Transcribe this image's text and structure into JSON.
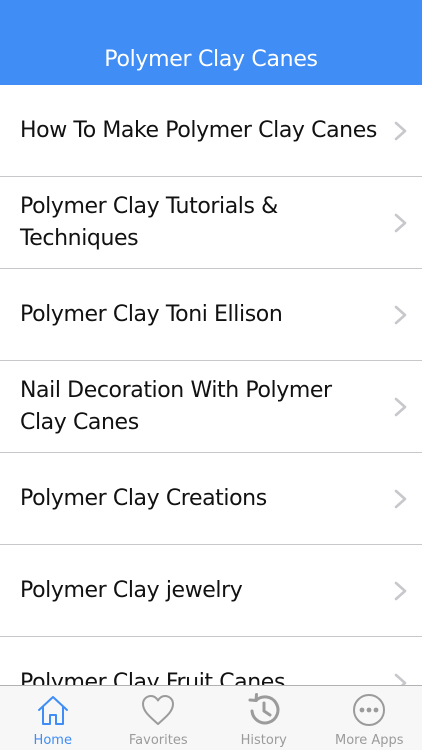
{
  "nav": {
    "title": "Polymer Clay Canes"
  },
  "list": {
    "items": [
      "How To Make Polymer Clay Canes",
      "Polymer Clay Tutorials & Techniques",
      "Polymer Clay Toni Ellison",
      "Nail Decoration With Polymer Clay Canes",
      "Polymer Clay Creations",
      "Polymer Clay jewelry",
      "Polymer Clay Fruit Canes"
    ]
  },
  "tabs": [
    {
      "label": "Home",
      "icon": "home-icon",
      "active": true
    },
    {
      "label": "Favorites",
      "icon": "heart-icon",
      "active": false
    },
    {
      "label": "History",
      "icon": "history-icon",
      "active": false
    },
    {
      "label": "More Apps",
      "icon": "more-icon",
      "active": false
    }
  ],
  "colors": {
    "accent": "#3f8df5",
    "tab_inactive": "#9b9b9b",
    "separator": "#c8c7cc"
  }
}
